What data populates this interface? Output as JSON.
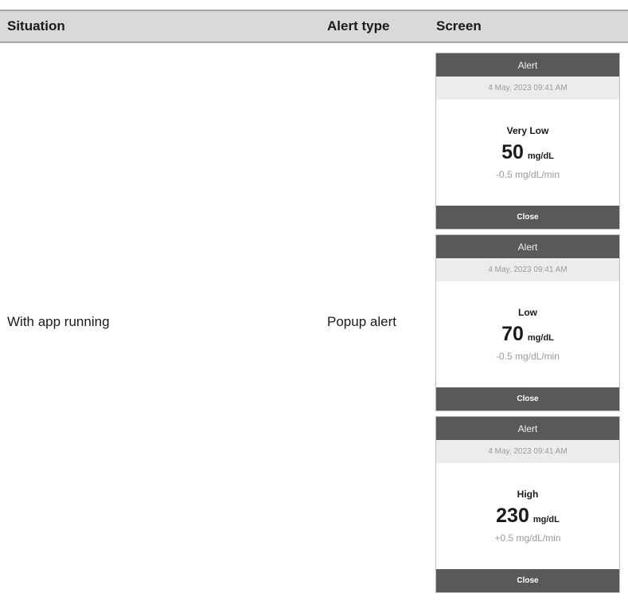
{
  "table": {
    "headers": {
      "situation": "Situation",
      "alert_type": "Alert type",
      "screen": "Screen"
    },
    "row": {
      "situation": "With app running",
      "alert_type": "Popup alert"
    }
  },
  "popups": [
    {
      "title": "Alert",
      "datetime": "4 May, 2023  09:41 AM",
      "level": "Very Low",
      "value": "50",
      "unit": "mg/dL",
      "trend": "-0.5 mg/dL/min",
      "close_label": "Close"
    },
    {
      "title": "Alert",
      "datetime": "4 May, 2023  09:41 AM",
      "level": "Low",
      "value": "70",
      "unit": "mg/dL",
      "trend": "-0.5 mg/dL/min",
      "close_label": "Close"
    },
    {
      "title": "Alert",
      "datetime": "4 May, 2023  09:41 AM",
      "level": "High",
      "value": "230",
      "unit": "mg/dL",
      "trend": "+0.5 mg/dL/min",
      "close_label": "Close"
    }
  ],
  "colors": {
    "header_bg": "#d9d9d9",
    "popup_bar": "#595959",
    "date_bar": "#ececec",
    "muted_text": "#9a9a9a"
  }
}
